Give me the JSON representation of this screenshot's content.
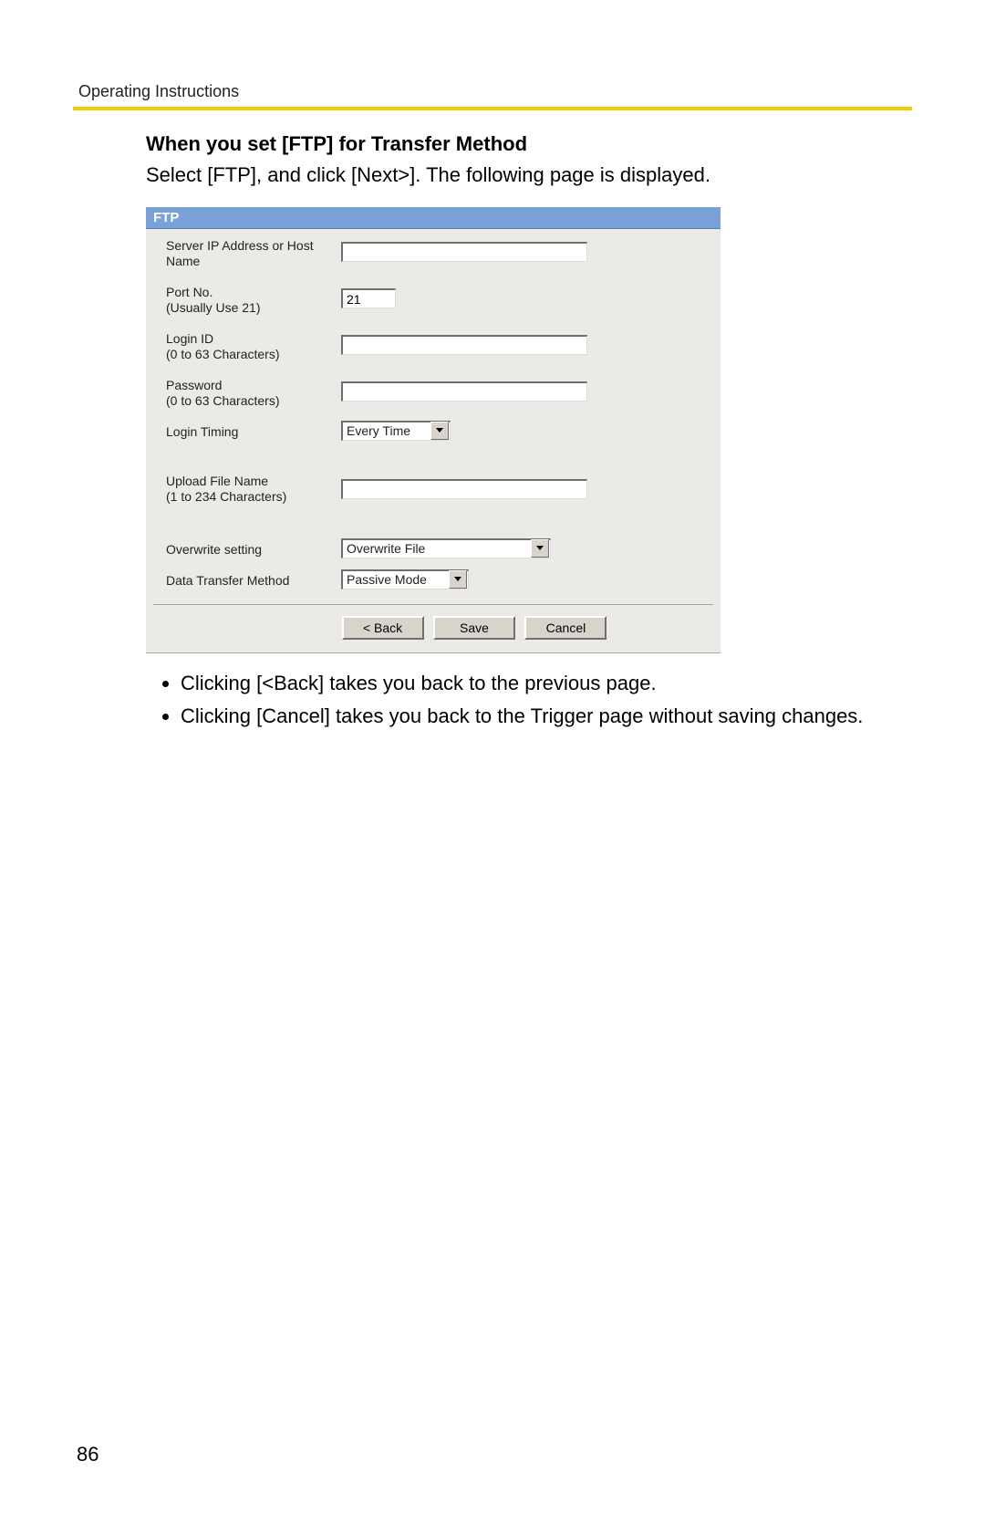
{
  "header": "Operating Instructions",
  "heading": "When you set [FTP] for Transfer Method",
  "intro": "Select [FTP], and click [Next>]. The following page is displayed.",
  "screenshot": {
    "title": "FTP",
    "fields": {
      "server": {
        "label": "Server IP Address or Host Name",
        "value": ""
      },
      "port": {
        "label": "Port No.\n(Usually Use 21)",
        "value": "21"
      },
      "login": {
        "label": "Login ID\n(0 to 63 Characters)",
        "value": ""
      },
      "password": {
        "label": "Password\n(0 to 63 Characters)",
        "value": ""
      },
      "login_timing": {
        "label": "Login Timing",
        "value": "Every Time"
      },
      "upload_file": {
        "label": "Upload File Name\n(1 to 234 Characters)",
        "value": ""
      },
      "overwrite": {
        "label": "Overwrite setting",
        "value": "Overwrite File"
      },
      "transfer_method": {
        "label": "Data Transfer Method",
        "value": "Passive Mode"
      }
    },
    "buttons": {
      "back": "< Back",
      "save": "Save",
      "cancel": "Cancel"
    }
  },
  "bullets": [
    "Clicking [<Back] takes you back to the previous page.",
    "Clicking [Cancel] takes you back to the Trigger page without saving changes."
  ],
  "page_number": "86"
}
